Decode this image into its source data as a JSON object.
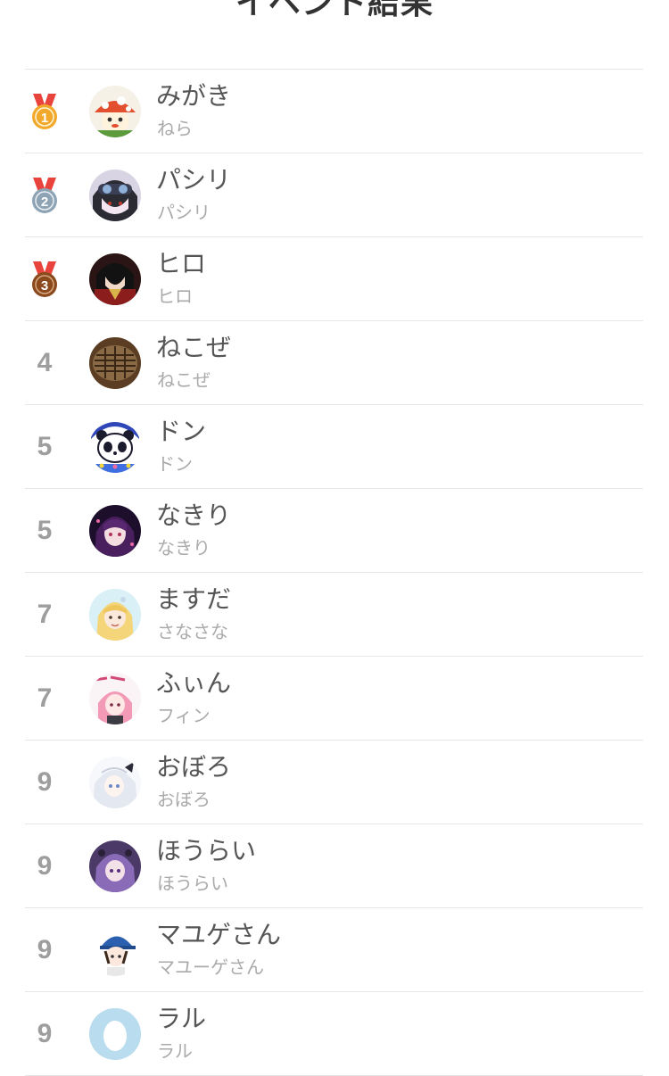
{
  "header": {
    "title": "イベント結果"
  },
  "colors": {
    "gold": "#f2a92b",
    "silver": "#8ea3b4",
    "bronze": "#8a4a1e",
    "ribbon": "#e8433c"
  },
  "ranking": [
    {
      "rank": "1",
      "medal": "gold-medal-icon",
      "name": "みがき",
      "sub": "ねら",
      "avatar": "mushroom-avatar-icon"
    },
    {
      "rank": "2",
      "medal": "silver-medal-icon",
      "name": "パシリ",
      "sub": "パシリ",
      "avatar": "goggles-character-avatar-icon"
    },
    {
      "rank": "3",
      "medal": "bronze-medal-icon",
      "name": "ヒロ",
      "sub": "ヒロ",
      "avatar": "dark-character-avatar-icon"
    },
    {
      "rank": "4",
      "name": "ねこぜ",
      "sub": "ねこぜ",
      "avatar": "grill-avatar-icon"
    },
    {
      "rank": "5",
      "name": "ドン",
      "sub": "ドン",
      "avatar": "panda-avatar-icon"
    },
    {
      "rank": "5",
      "name": "なきり",
      "sub": "なきり",
      "avatar": "purple-hair-avatar-icon"
    },
    {
      "rank": "7",
      "name": "ますだ",
      "sub": "さなさな",
      "avatar": "blonde-girl-avatar-icon"
    },
    {
      "rank": "7",
      "name": "ふぃん",
      "sub": "フィン",
      "avatar": "pink-hair-avatar-icon"
    },
    {
      "rank": "9",
      "name": "おぼろ",
      "sub": "おぼろ",
      "avatar": "white-hair-avatar-icon"
    },
    {
      "rank": "9",
      "name": "ほうらい",
      "sub": "ほうらい",
      "avatar": "violet-character-avatar-icon"
    },
    {
      "rank": "9",
      "name": "マユゲさん",
      "sub": "マユーゲさん",
      "avatar": "blue-cap-avatar-icon"
    },
    {
      "rank": "9",
      "name": "ラル",
      "sub": "ラル",
      "avatar": "egg-default-avatar-icon"
    }
  ]
}
